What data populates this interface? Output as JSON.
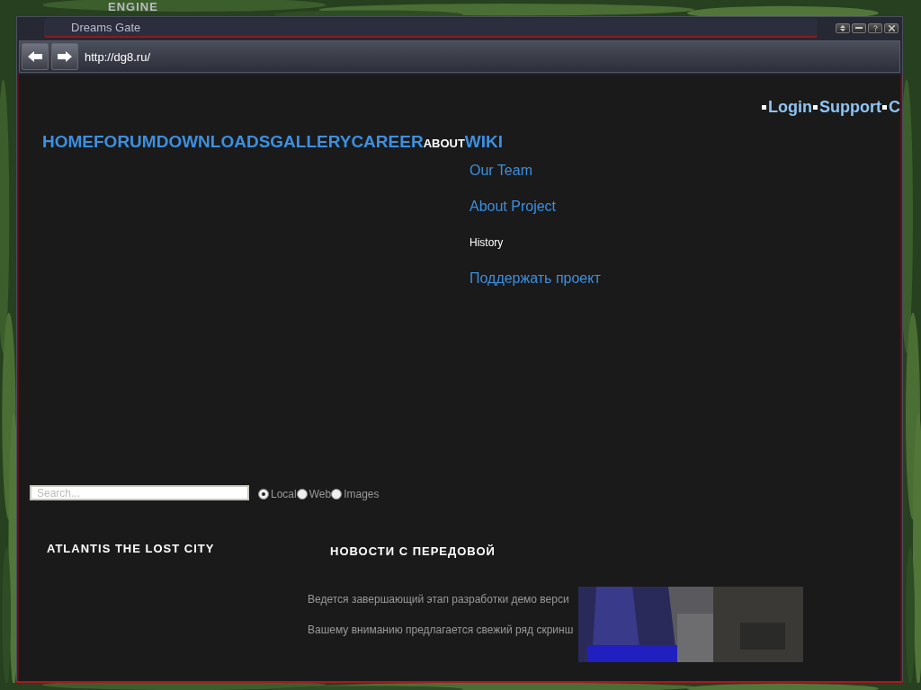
{
  "background": {
    "kind": "picture",
    "logo": "ENGINE"
  },
  "window": {
    "title": "Dreams Gate"
  },
  "address_bar": {
    "url": "http://dg8.ru/"
  },
  "user_links": [
    "Login",
    "Support",
    "C"
  ],
  "nav": [
    {
      "label": "HOME",
      "selected": false
    },
    {
      "label": "FORUM",
      "selected": false
    },
    {
      "label": "DOWNLOADS",
      "selected": false
    },
    {
      "label": "GALLERY",
      "selected": false
    },
    {
      "label": "CAREER",
      "selected": false
    },
    {
      "label": "ABOUT",
      "selected": true
    },
    {
      "label": "WIKI",
      "selected": false
    }
  ],
  "about_menu": [
    {
      "label": "Our Team",
      "selected": false
    },
    {
      "label": "About Project",
      "selected": false
    },
    {
      "label": "History",
      "selected": true
    },
    {
      "label": "Поддержать проект",
      "selected": false
    }
  ],
  "search": {
    "placeholder": "Search...",
    "scopes": [
      {
        "label": "Local",
        "selected": true
      },
      {
        "label": "Web",
        "selected": false
      },
      {
        "label": "Images",
        "selected": false
      }
    ]
  },
  "sidebar": {
    "title": "ATLANTIS THE LOST CITY"
  },
  "news": {
    "title": "НОВОСТИ С ПЕРЕДОВОЙ",
    "lines": [
      "Ведется завершающий этап разработки демо верси",
      "Вашему вниманию предлагается свежий ряд скринш"
    ],
    "image": {
      "kind": "picture"
    }
  }
}
